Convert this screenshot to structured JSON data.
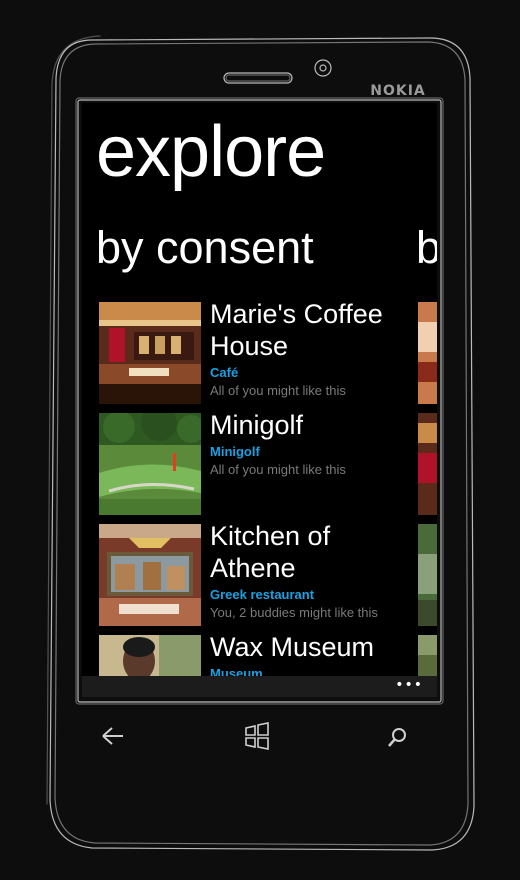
{
  "device": {
    "brand": "NOKIA"
  },
  "page": {
    "title": "explore",
    "pivot_current": "by consent",
    "pivot_next": "b"
  },
  "places": [
    {
      "name": "Marie's Coffee House",
      "category": "Café",
      "like": "All of you might like this"
    },
    {
      "name": "Minigolf",
      "category": "Minigolf",
      "like": "All of you might like this"
    },
    {
      "name": "Kitchen of Athene",
      "category": "Greek restaurant",
      "like": "You, 2 buddies might like this"
    },
    {
      "name": "Wax Museum",
      "category": "Museum",
      "like": ""
    }
  ],
  "appbar": {
    "more": "•••"
  },
  "colors": {
    "accent": "#1ba1e2",
    "background": "#000000",
    "secondary_text": "#7a7a7a"
  },
  "hardware_keys": [
    "back-icon",
    "windows-icon",
    "search-icon"
  ]
}
